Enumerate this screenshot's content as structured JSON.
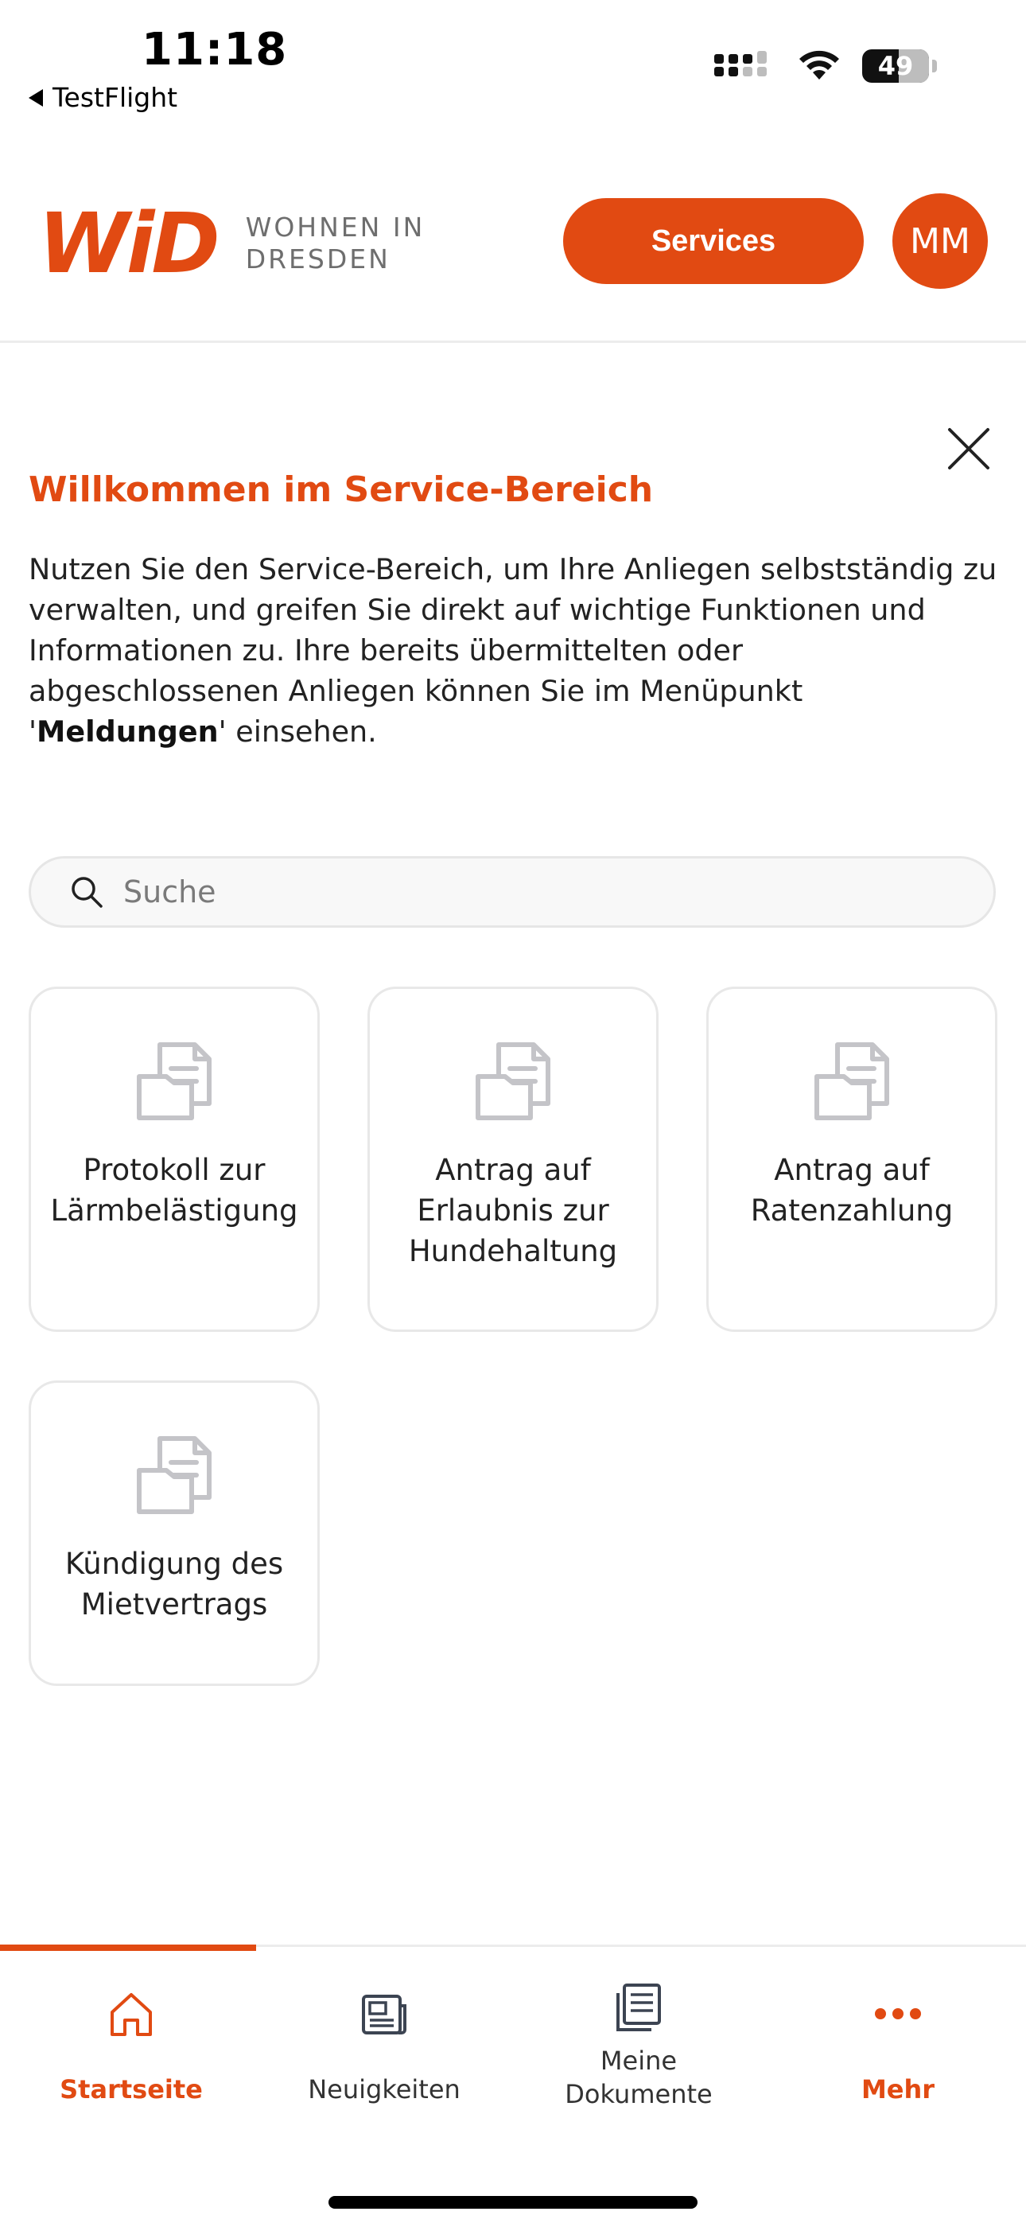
{
  "status_bar": {
    "time": "11:18",
    "back_label": "TestFlight",
    "battery": "49"
  },
  "header": {
    "logo_mark": "WiD",
    "logo_line1": "WOHNEN IN",
    "logo_line2": "DRESDEN",
    "services_label": "Services",
    "avatar_initials": "MM"
  },
  "welcome": {
    "title": "Willkommen im Service-Bereich",
    "text_before": "Nutzen Sie den Service-Bereich, um Ihre Anliegen selbstständig zu verwalten, und greifen Sie direkt auf wichtige Funktionen und Informationen zu. Ihre bereits übermittelten oder abgeschlossenen Anliegen können Sie im Menüpunkt '",
    "text_bold": "Meldungen",
    "text_after": "' einsehen."
  },
  "search": {
    "placeholder": "Suche"
  },
  "tiles": [
    {
      "label": "Protokoll zur Lärmbelästigung"
    },
    {
      "label": "Antrag auf Erlaubnis zur Hundehaltung"
    },
    {
      "label": "Antrag auf Ratenzahlung"
    },
    {
      "label": "Kündigung des Mietvertrags"
    }
  ],
  "bottom_nav": {
    "items": [
      {
        "label": "Startseite",
        "icon": "home-icon"
      },
      {
        "label": "Neuigkeiten",
        "icon": "newspaper-icon"
      },
      {
        "label": "Meine Dokumente",
        "icon": "documents-icon"
      },
      {
        "label": "Mehr",
        "icon": "more-dots-icon"
      }
    ]
  },
  "colors": {
    "accent": "#e14a12",
    "icon_gray": "#c4c4c8",
    "nav_icon": "#3c4452"
  }
}
